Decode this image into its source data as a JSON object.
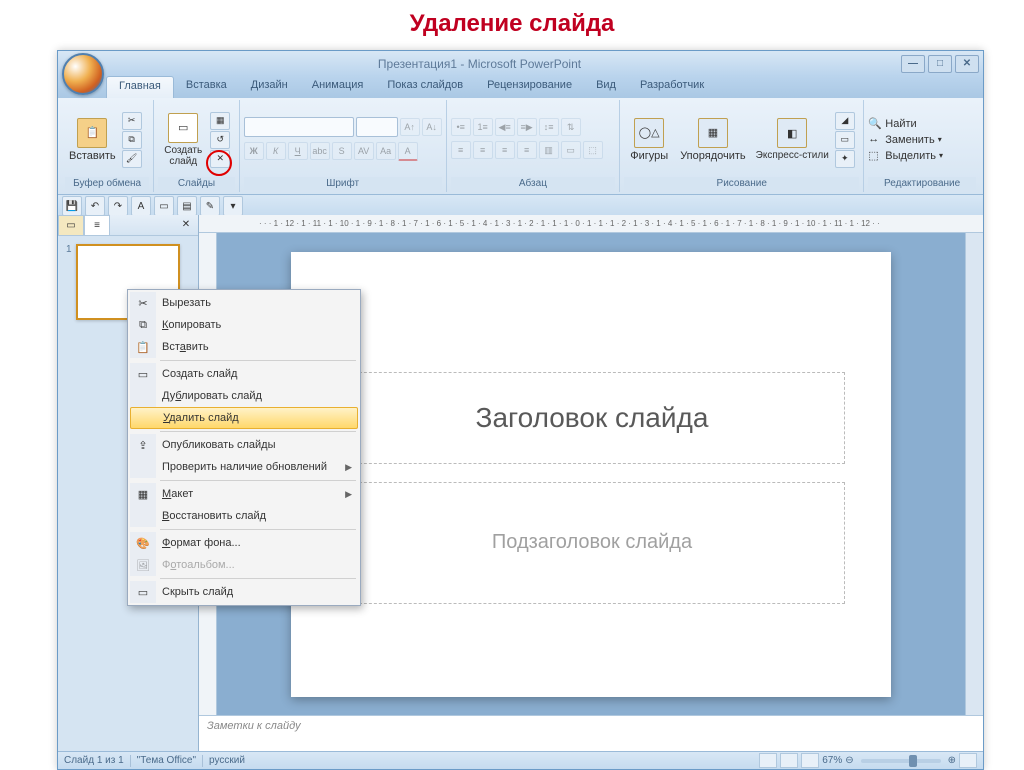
{
  "lesson_title": "Удаление слайда",
  "window_title": "Презентация1 - Microsoft PowerPoint",
  "tabs": [
    "Главная",
    "Вставка",
    "Дизайн",
    "Анимация",
    "Показ слайдов",
    "Рецензирование",
    "Вид",
    "Разработчик"
  ],
  "ribbon": {
    "clipboard": {
      "label": "Буфер обмена",
      "paste": "Вставить"
    },
    "slides": {
      "label": "Слайды",
      "new_slide": "Создать\nслайд"
    },
    "font": {
      "label": "Шрифт"
    },
    "paragraph": {
      "label": "Абзац"
    },
    "drawing": {
      "label": "Рисование",
      "shapes": "Фигуры",
      "arrange": "Упорядочить",
      "styles": "Экспресс-стили"
    },
    "editing": {
      "label": "Редактирование",
      "find": "Найти",
      "replace": "Заменить",
      "select": "Выделить"
    }
  },
  "slide": {
    "title_placeholder": "Заголовок слайда",
    "subtitle_placeholder": "Подзаголовок слайда"
  },
  "notes_placeholder": "Заметки к слайду",
  "status": {
    "slide_info": "Слайд 1 из 1",
    "theme": "\"Тема Office\"",
    "lang": "русский",
    "zoom": "67%"
  },
  "hruler_text": "· · · 1 · 12 · 1 · 11 · 1 · 10 · 1 · 9 · 1 · 8 · 1 · 7 · 1 · 6 · 1 · 5 · 1 · 4 · 1 · 3 · 1 · 2 · 1 · 1 · 1 · 0 · 1 · 1 · 1 · 2 · 1 · 3 · 1 · 4 · 1 · 5 · 1 · 6 · 1 · 7 · 1 · 8 · 1 · 9 · 1 · 10 · 1 · 11 · 1 · 12 · ·",
  "context_menu": {
    "cut": "Вырезать",
    "copy": "Копировать",
    "paste": "Вставить",
    "new_slide": "Создать слайд",
    "duplicate": "Дублировать слайд",
    "delete": "Удалить слайд",
    "publish": "Опубликовать слайды",
    "check_updates": "Проверить наличие обновлений",
    "layout": "Макет",
    "reset": "Восстановить слайд",
    "format_bg": "Формат фона...",
    "photo_album": "Фотоальбом...",
    "hide": "Скрыть слайд"
  }
}
